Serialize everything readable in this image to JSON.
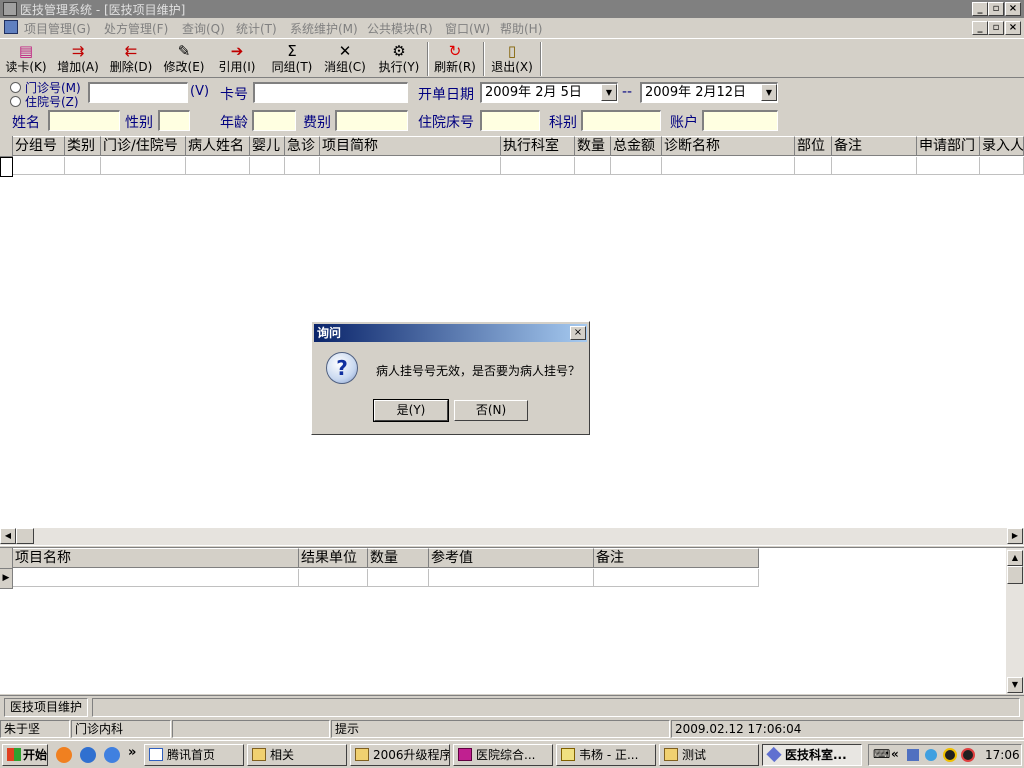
{
  "window": {
    "title": "医技管理系统 - [医技项目维护]"
  },
  "menu": [
    "项目管理(G)",
    "处方管理(F)",
    "查询(Q)",
    "统计(T)",
    "系统维护(M)",
    "公共模块(R)",
    "窗口(W)",
    "帮助(H)"
  ],
  "toolbar": [
    {
      "label": "读卡(K)",
      "icon": "card-reader-icon"
    },
    {
      "label": "增加(A)",
      "icon": "add-icon"
    },
    {
      "label": "删除(D)",
      "icon": "delete-icon"
    },
    {
      "label": "修改(E)",
      "icon": "edit-icon"
    },
    {
      "label": "引用(I)",
      "icon": "reference-icon"
    },
    {
      "label": "同组(T)",
      "icon": "sigma-icon"
    },
    {
      "label": "消组(C)",
      "icon": "cross-icon"
    },
    {
      "label": "执行(Y)",
      "icon": "gear-icon"
    },
    {
      "label": "刷新(R)",
      "icon": "refresh-icon"
    },
    {
      "label": "退出(X)",
      "icon": "exit-door-icon"
    }
  ],
  "filters": {
    "radio_outpatient": "门诊号(M)",
    "radio_inpatient": "住院号(Z)",
    "v_label": "(V)",
    "card_no": "卡号",
    "open_date": "开单日期",
    "date_from": "2009年 2月 5日",
    "date_sep": "--",
    "date_to": "2009年 2月12日",
    "name": "姓名",
    "gender": "性别",
    "age": "年龄",
    "fee_type": "费别",
    "bed_no": "住院床号",
    "department": "科别",
    "account": "账户"
  },
  "main_grid": {
    "columns": [
      "分组号",
      "类别",
      "门诊/住院号",
      "病人姓名",
      "婴儿",
      "急诊",
      "项目简称",
      "执行科室",
      "数量",
      "总金额",
      "诊断名称",
      "部位",
      "备注",
      "申请部门",
      "录入人"
    ]
  },
  "detail_grid": {
    "columns": [
      "项目名称",
      "结果单位",
      "数量",
      "参考值",
      "备注"
    ]
  },
  "dialog": {
    "title": "询问",
    "message": "病人挂号号无效，是否要为病人挂号？",
    "yes": "是(Y)",
    "no": "否(N)"
  },
  "mdi_tab": "医技项目维护",
  "status": {
    "user": "朱于坚",
    "dept": "门诊内科",
    "hint": "提示",
    "datetime": "2009.02.12 17:06:04"
  },
  "taskbar": {
    "start": "开始",
    "chevron": "»",
    "items": [
      "腾讯首页",
      "相关",
      "2006升级程序",
      "医院综合...",
      "韦杨 - 正...",
      "测试",
      "医技科室..."
    ],
    "tray_chevron": "«",
    "clock": "17:06"
  },
  "colors": {
    "dialog_title": "#0a246a",
    "yellow_field": "#ffffe1",
    "label_blue": "#000080"
  }
}
